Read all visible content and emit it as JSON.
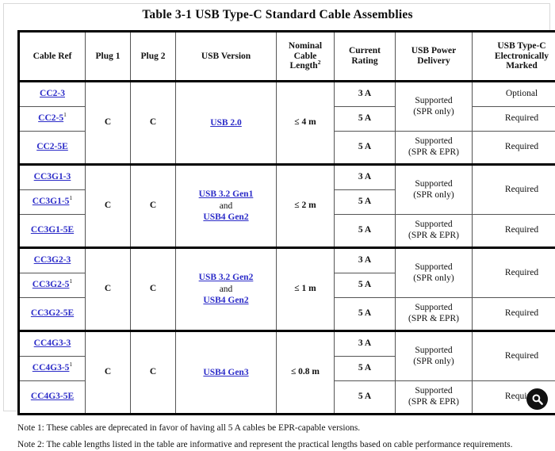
{
  "document": {
    "title": "Table 3-1  USB Type-C Standard Cable Assemblies"
  },
  "table": {
    "headers": [
      "Cable Ref",
      "Plug 1",
      "Plug 2",
      "USB Version",
      "Nominal Cable Length",
      "Current Rating",
      "USB Power Delivery",
      "USB Type-C Electronically Marked"
    ],
    "header_nominal": {
      "line1": "Nominal",
      "line2": "Cable",
      "line3": "Length",
      "sup": "2"
    },
    "header_current": {
      "line1": "Current",
      "line2": "Rating"
    },
    "header_pd": {
      "line1": "USB Power",
      "line2": "Delivery"
    },
    "header_em": {
      "line1": "USB Type-C",
      "line2": "Electronically",
      "line3": "Marked"
    },
    "groups": [
      {
        "id": "cc2",
        "plug1": "C",
        "plug2": "C",
        "usb_version": {
          "links": [
            "USB 2.0"
          ],
          "conjunction": ""
        },
        "length": "≤ 4 m",
        "rows": [
          {
            "ref": "CC2-3",
            "ref_sup": "",
            "current": "3 A",
            "pd": "Supported (SPR only)",
            "pd_line1": "Supported",
            "pd_line2": "(SPR only)",
            "em": "Optional"
          },
          {
            "ref": "CC2-5",
            "ref_sup": "1",
            "current": "5 A",
            "em": "Required"
          },
          {
            "ref": "CC2-5E",
            "ref_sup": "",
            "current": "5 A",
            "pd_line1": "Supported",
            "pd_line2": "(SPR & EPR)",
            "em": "Required"
          }
        ],
        "em_merged": false
      },
      {
        "id": "cc3g1",
        "plug1": "C",
        "plug2": "C",
        "usb_version": {
          "links": [
            "USB 3.2 Gen1",
            "USB4 Gen2"
          ],
          "conjunction": "and"
        },
        "length": "≤ 2 m",
        "rows": [
          {
            "ref": "CC3G1-3",
            "ref_sup": "",
            "current": "3 A",
            "pd_line1": "Supported",
            "pd_line2": "(SPR only)",
            "em": "Required"
          },
          {
            "ref": "CC3G1-5",
            "ref_sup": "1",
            "current": "5 A"
          },
          {
            "ref": "CC3G1-5E",
            "ref_sup": "",
            "current": "5 A",
            "pd_line1": "Supported",
            "pd_line2": "(SPR & EPR)",
            "em": "Required"
          }
        ],
        "em_merged": true
      },
      {
        "id": "cc3g2",
        "plug1": "C",
        "plug2": "C",
        "usb_version": {
          "links": [
            "USB 3.2 Gen2",
            "USB4 Gen2"
          ],
          "conjunction": "and"
        },
        "length": "≤ 1 m",
        "rows": [
          {
            "ref": "CC3G2-3",
            "ref_sup": "",
            "current": "3 A",
            "pd_line1": "Supported",
            "pd_line2": "(SPR only)",
            "em": "Required"
          },
          {
            "ref": "CC3G2-5",
            "ref_sup": "1",
            "current": "5 A"
          },
          {
            "ref": "CC3G2-5E",
            "ref_sup": "",
            "current": "5 A",
            "pd_line1": "Supported",
            "pd_line2": "(SPR & EPR)",
            "em": "Required"
          }
        ],
        "em_merged": true
      },
      {
        "id": "cc4g3",
        "plug1": "C",
        "plug2": "C",
        "usb_version": {
          "links": [
            "USB4 Gen3"
          ],
          "conjunction": ""
        },
        "length": "≤ 0.8 m",
        "rows": [
          {
            "ref": "CC4G3-3",
            "ref_sup": "",
            "current": "3 A",
            "pd_line1": "Supported",
            "pd_line2": "(SPR only)",
            "em": "Required"
          },
          {
            "ref": "CC4G3-5",
            "ref_sup": "1",
            "current": "5 A"
          },
          {
            "ref": "CC4G3-5E",
            "ref_sup": "",
            "current": "5 A",
            "pd_line1": "Supported",
            "pd_line2": "(SPR & EPR)",
            "em": "Required"
          }
        ],
        "em_merged": true
      }
    ]
  },
  "notes": [
    "Note 1: These cables are deprecated in favor of having all 5 A cables be EPR-capable versions.",
    "Note 2: The cable lengths listed in the table are informative and represent the practical lengths based on cable performance requirements."
  ],
  "badge": {
    "icon": "magnifier-icon",
    "background": "#111111"
  },
  "colors": {
    "link": "#2b2bc8",
    "text": "#111111",
    "border": "#000000",
    "page_border": "#d9d9d9"
  }
}
